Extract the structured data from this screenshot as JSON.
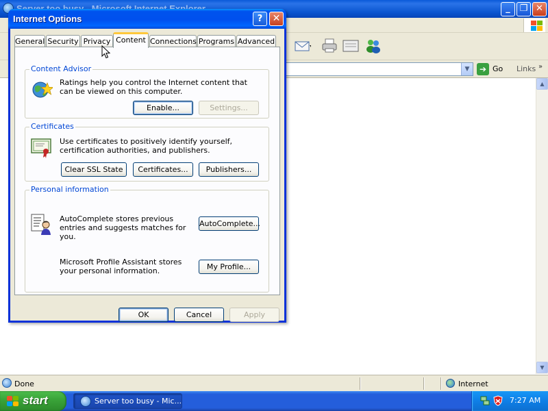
{
  "ie_window": {
    "title": "Server too busy - Microsoft Internet Explorer",
    "caption_min": "_",
    "caption_max": "❐",
    "caption_close": "✕",
    "go_label": "Go",
    "links_label": "Links",
    "links_chevron": "»",
    "status_text": "Done",
    "zone_text": "Internet"
  },
  "taskbar": {
    "start_label": "start",
    "task_label": "Server too busy - Mic...",
    "clock": "7:27 AM"
  },
  "dialog": {
    "title": "Internet Options",
    "help_glyph": "?",
    "close_glyph": "✕",
    "tabs": [
      {
        "label": "General"
      },
      {
        "label": "Security"
      },
      {
        "label": "Privacy"
      },
      {
        "label": "Content"
      },
      {
        "label": "Connections"
      },
      {
        "label": "Programs"
      },
      {
        "label": "Advanced"
      }
    ],
    "active_tab": "Content",
    "content_advisor": {
      "title": "Content Advisor",
      "text": "Ratings help you control the Internet content that can be viewed on this computer.",
      "enable_label": "Enable...",
      "settings_label": "Settings..."
    },
    "certificates": {
      "title": "Certificates",
      "text": "Use certificates to positively identify yourself, certification authorities, and publishers.",
      "clear_ssl_label": "Clear SSL State",
      "certificates_label": "Certificates...",
      "publishers_label": "Publishers..."
    },
    "personal_information": {
      "title": "Personal information",
      "autocomplete_text": "AutoComplete stores previous entries and suggests matches for you.",
      "autocomplete_label": "AutoComplete...",
      "profile_text": "Microsoft Profile Assistant stores your personal information.",
      "profile_label": "My Profile..."
    },
    "footer": {
      "ok_label": "OK",
      "cancel_label": "Cancel",
      "apply_label": "Apply"
    }
  },
  "colors": {
    "xp_blue": "#0053ee",
    "dialog_face": "#ece9d8",
    "group_title": "#0046d5",
    "start_green": "#3ba53a",
    "active_tab_accent": "#ffc83c"
  }
}
